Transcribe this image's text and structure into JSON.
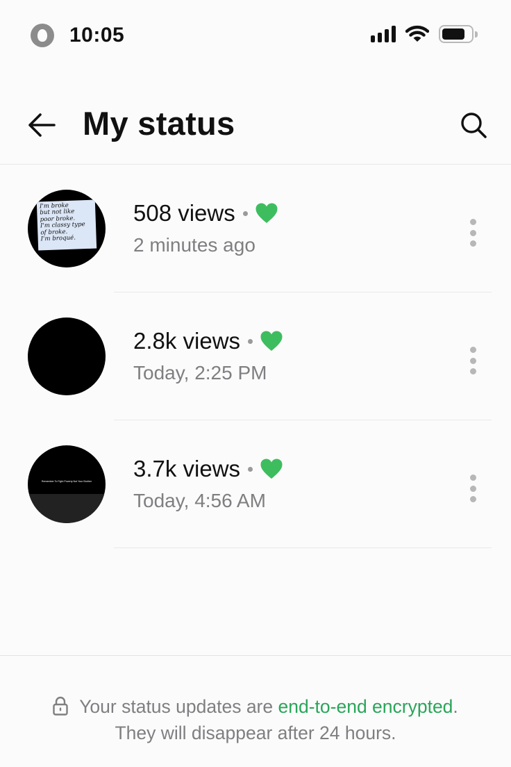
{
  "status_bar": {
    "time": "10:05",
    "icons": [
      "app-icon",
      "cellular-signal-icon",
      "wifi-icon",
      "battery-icon"
    ],
    "battery_level": 0.8
  },
  "header": {
    "title": "My status",
    "back_icon": "arrow-left-icon",
    "search_icon": "search-icon"
  },
  "statuses": [
    {
      "views": "508 views",
      "time": "2 minutes ago",
      "reaction_icon": "heart-icon",
      "thumb_note": [
        "I'm broke",
        "but not like",
        "poor broke.",
        "I'm classy type",
        "of broke.",
        "I'm broqué."
      ]
    },
    {
      "views": "2.8k views",
      "time": "Today, 2:25 PM",
      "reaction_icon": "heart-icon"
    },
    {
      "views": "3.7k views",
      "time": "Today, 4:56 AM",
      "reaction_icon": "heart-icon",
      "thumb_caption": "Remember To Fight Poverty Not Your Brother"
    }
  ],
  "footer": {
    "prefix": "Your status updates are ",
    "link": "end-to-end encrypted",
    "suffix": ".",
    "line2": "They will disappear after 24 hours."
  },
  "colors": {
    "accent_green": "#2aa55a",
    "heart_green": "#3ebd5f",
    "secondary_text": "#7f7f82"
  }
}
